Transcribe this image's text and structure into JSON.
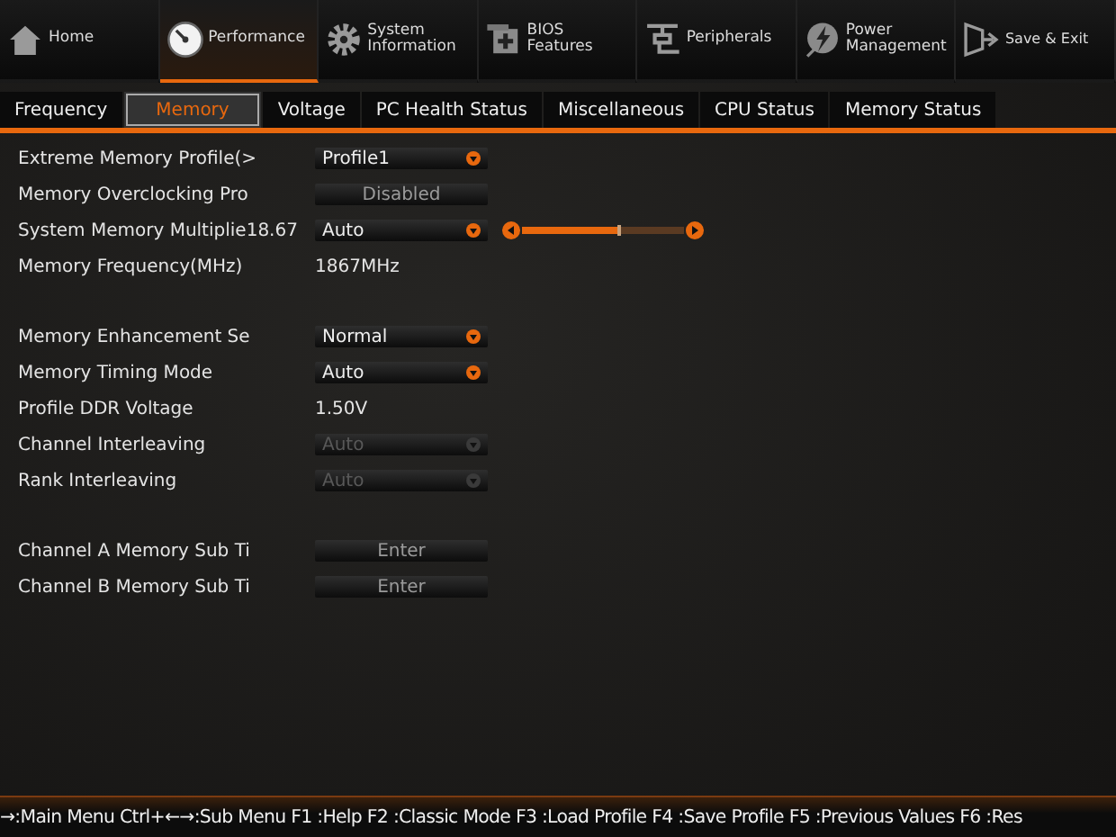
{
  "top_menu": [
    {
      "label": "Home",
      "kind": "home",
      "selected": false
    },
    {
      "label": "Performance",
      "kind": "gauge",
      "selected": true
    },
    {
      "label": "System Information",
      "kind": "gear",
      "selected": false
    },
    {
      "label": "BIOS Features",
      "kind": "chip",
      "selected": false
    },
    {
      "label": "Peripherals",
      "kind": "plug",
      "selected": false
    },
    {
      "label": "Power Management",
      "kind": "power",
      "selected": false
    },
    {
      "label": "Save & Exit",
      "kind": "exit",
      "selected": false
    }
  ],
  "tabs": [
    {
      "label": "Frequency",
      "selected": false
    },
    {
      "label": "Memory",
      "selected": true
    },
    {
      "label": "Voltage",
      "selected": false
    },
    {
      "label": "PC Health Status",
      "selected": false
    },
    {
      "label": "Miscellaneous",
      "selected": false
    },
    {
      "label": "CPU Status",
      "selected": false
    },
    {
      "label": "Memory Status",
      "selected": false
    }
  ],
  "sections": [
    [
      {
        "label": "Extreme Memory Profile(>",
        "kind": "select",
        "value": "Profile1",
        "disabled": false
      },
      {
        "label": "Memory Overclocking Pro",
        "kind": "button",
        "value": "Disabled"
      },
      {
        "label": "System Memory Multiplie",
        "reading": "18.67",
        "kind": "select",
        "value": "Auto",
        "disabled": false,
        "slider": {
          "level": 0.6
        }
      },
      {
        "label": "Memory Frequency(MHz)",
        "kind": "value",
        "value": "1867MHz"
      }
    ],
    [
      {
        "label": "Memory Enhancement Se",
        "kind": "select",
        "value": "Normal",
        "disabled": false
      },
      {
        "label": "Memory Timing Mode",
        "kind": "select",
        "value": "Auto",
        "disabled": false
      },
      {
        "label": "Profile DDR Voltage",
        "kind": "value",
        "value": "1.50V"
      },
      {
        "label": "Channel Interleaving",
        "kind": "select",
        "value": "Auto",
        "disabled": true
      },
      {
        "label": "Rank Interleaving",
        "kind": "select",
        "value": "Auto",
        "disabled": true
      }
    ],
    [
      {
        "label": "Channel A Memory Sub Ti",
        "kind": "button",
        "value": "Enter"
      },
      {
        "label": "Channel B Memory Sub Ti",
        "kind": "button",
        "value": "Enter"
      }
    ]
  ],
  "footer": "→:Main Menu Ctrl+←→:Sub Menu F1 :Help F2 :Classic Mode F3 :Load Profile F4 :Save Profile F5 :Previous Values F6 :Res"
}
